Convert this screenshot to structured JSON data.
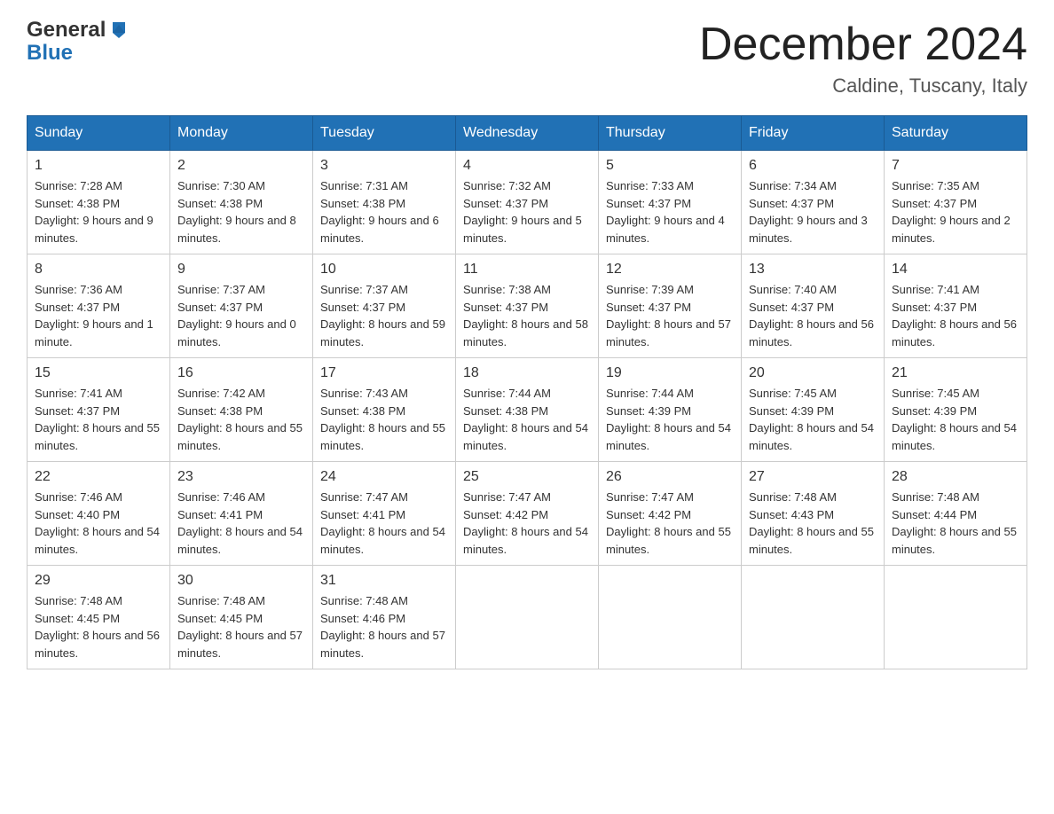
{
  "header": {
    "logo_general": "General",
    "logo_blue": "Blue",
    "title": "December 2024",
    "location": "Caldine, Tuscany, Italy"
  },
  "days_of_week": [
    "Sunday",
    "Monday",
    "Tuesday",
    "Wednesday",
    "Thursday",
    "Friday",
    "Saturday"
  ],
  "weeks": [
    [
      {
        "day": "1",
        "sunrise": "7:28 AM",
        "sunset": "4:38 PM",
        "daylight": "9 hours and 9 minutes."
      },
      {
        "day": "2",
        "sunrise": "7:30 AM",
        "sunset": "4:38 PM",
        "daylight": "9 hours and 8 minutes."
      },
      {
        "day": "3",
        "sunrise": "7:31 AM",
        "sunset": "4:38 PM",
        "daylight": "9 hours and 6 minutes."
      },
      {
        "day": "4",
        "sunrise": "7:32 AM",
        "sunset": "4:37 PM",
        "daylight": "9 hours and 5 minutes."
      },
      {
        "day": "5",
        "sunrise": "7:33 AM",
        "sunset": "4:37 PM",
        "daylight": "9 hours and 4 minutes."
      },
      {
        "day": "6",
        "sunrise": "7:34 AM",
        "sunset": "4:37 PM",
        "daylight": "9 hours and 3 minutes."
      },
      {
        "day": "7",
        "sunrise": "7:35 AM",
        "sunset": "4:37 PM",
        "daylight": "9 hours and 2 minutes."
      }
    ],
    [
      {
        "day": "8",
        "sunrise": "7:36 AM",
        "sunset": "4:37 PM",
        "daylight": "9 hours and 1 minute."
      },
      {
        "day": "9",
        "sunrise": "7:37 AM",
        "sunset": "4:37 PM",
        "daylight": "9 hours and 0 minutes."
      },
      {
        "day": "10",
        "sunrise": "7:37 AM",
        "sunset": "4:37 PM",
        "daylight": "8 hours and 59 minutes."
      },
      {
        "day": "11",
        "sunrise": "7:38 AM",
        "sunset": "4:37 PM",
        "daylight": "8 hours and 58 minutes."
      },
      {
        "day": "12",
        "sunrise": "7:39 AM",
        "sunset": "4:37 PM",
        "daylight": "8 hours and 57 minutes."
      },
      {
        "day": "13",
        "sunrise": "7:40 AM",
        "sunset": "4:37 PM",
        "daylight": "8 hours and 56 minutes."
      },
      {
        "day": "14",
        "sunrise": "7:41 AM",
        "sunset": "4:37 PM",
        "daylight": "8 hours and 56 minutes."
      }
    ],
    [
      {
        "day": "15",
        "sunrise": "7:41 AM",
        "sunset": "4:37 PM",
        "daylight": "8 hours and 55 minutes."
      },
      {
        "day": "16",
        "sunrise": "7:42 AM",
        "sunset": "4:38 PM",
        "daylight": "8 hours and 55 minutes."
      },
      {
        "day": "17",
        "sunrise": "7:43 AM",
        "sunset": "4:38 PM",
        "daylight": "8 hours and 55 minutes."
      },
      {
        "day": "18",
        "sunrise": "7:44 AM",
        "sunset": "4:38 PM",
        "daylight": "8 hours and 54 minutes."
      },
      {
        "day": "19",
        "sunrise": "7:44 AM",
        "sunset": "4:39 PM",
        "daylight": "8 hours and 54 minutes."
      },
      {
        "day": "20",
        "sunrise": "7:45 AM",
        "sunset": "4:39 PM",
        "daylight": "8 hours and 54 minutes."
      },
      {
        "day": "21",
        "sunrise": "7:45 AM",
        "sunset": "4:39 PM",
        "daylight": "8 hours and 54 minutes."
      }
    ],
    [
      {
        "day": "22",
        "sunrise": "7:46 AM",
        "sunset": "4:40 PM",
        "daylight": "8 hours and 54 minutes."
      },
      {
        "day": "23",
        "sunrise": "7:46 AM",
        "sunset": "4:41 PM",
        "daylight": "8 hours and 54 minutes."
      },
      {
        "day": "24",
        "sunrise": "7:47 AM",
        "sunset": "4:41 PM",
        "daylight": "8 hours and 54 minutes."
      },
      {
        "day": "25",
        "sunrise": "7:47 AM",
        "sunset": "4:42 PM",
        "daylight": "8 hours and 54 minutes."
      },
      {
        "day": "26",
        "sunrise": "7:47 AM",
        "sunset": "4:42 PM",
        "daylight": "8 hours and 55 minutes."
      },
      {
        "day": "27",
        "sunrise": "7:48 AM",
        "sunset": "4:43 PM",
        "daylight": "8 hours and 55 minutes."
      },
      {
        "day": "28",
        "sunrise": "7:48 AM",
        "sunset": "4:44 PM",
        "daylight": "8 hours and 55 minutes."
      }
    ],
    [
      {
        "day": "29",
        "sunrise": "7:48 AM",
        "sunset": "4:45 PM",
        "daylight": "8 hours and 56 minutes."
      },
      {
        "day": "30",
        "sunrise": "7:48 AM",
        "sunset": "4:45 PM",
        "daylight": "8 hours and 57 minutes."
      },
      {
        "day": "31",
        "sunrise": "7:48 AM",
        "sunset": "4:46 PM",
        "daylight": "8 hours and 57 minutes."
      },
      null,
      null,
      null,
      null
    ]
  ],
  "labels": {
    "sunrise": "Sunrise:",
    "sunset": "Sunset:",
    "daylight": "Daylight:"
  }
}
